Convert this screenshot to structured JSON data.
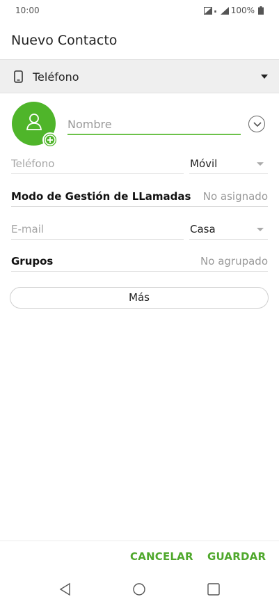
{
  "status_bar": {
    "time": "10:00",
    "battery": "100%"
  },
  "header": {
    "title": "Nuevo Contacto"
  },
  "account": {
    "label": "Teléfono"
  },
  "form": {
    "name_placeholder": "Nombre",
    "phone_placeholder": "Teléfono",
    "phone_type": "Móvil",
    "call_mode_label": "Modo de Gestión de LLamadas",
    "call_mode_value": "No asignado",
    "email_placeholder": "E-mail",
    "email_type": "Casa",
    "groups_label": "Grupos",
    "groups_value": "No agrupado",
    "more_label": "Más"
  },
  "actions": {
    "cancel": "CANCELAR",
    "save": "GUARDAR"
  },
  "colors": {
    "accent": "#4fb52a",
    "action_text": "#4fa82c",
    "account_bar": "#efefef"
  },
  "icons": [
    "signal-icon",
    "battery-icon",
    "phone-icon",
    "dropdown-arrow-icon",
    "person-icon",
    "add-photo-icon",
    "expand-icon",
    "back-icon",
    "home-icon",
    "recents-icon"
  ]
}
